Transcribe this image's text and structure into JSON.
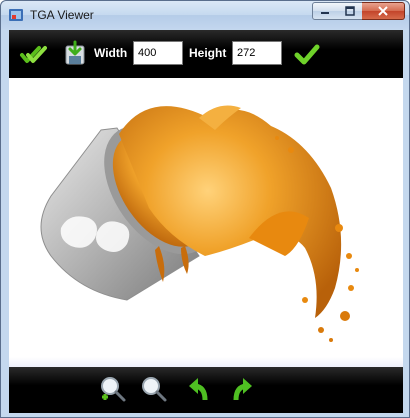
{
  "window": {
    "title": "TGA Viewer"
  },
  "toolbar": {
    "width_label": "Width",
    "width_value": "400",
    "height_label": "Height",
    "height_value": "272"
  },
  "icons": {
    "open": "double-check-icon",
    "save": "save-download-icon",
    "apply": "check-icon",
    "zoom_in": "zoom-in-icon",
    "zoom_out": "zoom-out-icon",
    "rotate_left": "rotate-left-icon",
    "rotate_right": "rotate-right-icon"
  },
  "image": {
    "description_label": "",
    "colors": {
      "paint": "#e8890f",
      "bucket": "#b9b9b9"
    }
  }
}
